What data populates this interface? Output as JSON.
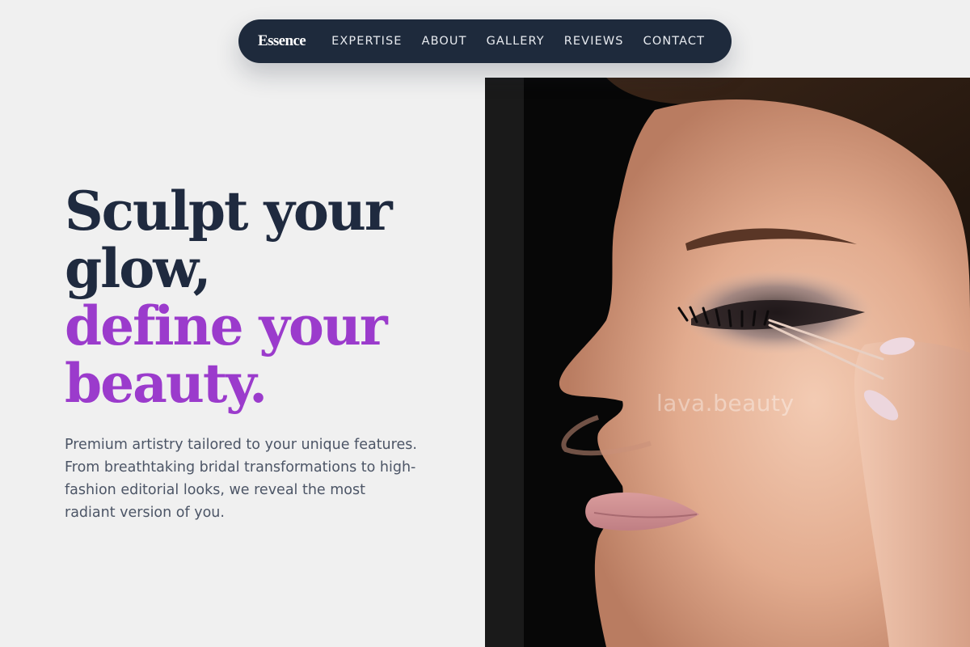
{
  "nav": {
    "brand": "Essence",
    "links": [
      "EXPERTISE",
      "ABOUT",
      "GALLERY",
      "REVIEWS",
      "CONTACT"
    ]
  },
  "hero": {
    "headline_line1": "Sculpt your",
    "headline_line2": "glow,",
    "headline_accent_line1": "define your",
    "headline_accent_line2": "beauty.",
    "lead": "Premium artistry tailored to your unique features. From breathtaking bridal transformations to high-fashion editorial looks, we reveal the most radiant version of you.",
    "image_watermark": "lava.beauty"
  },
  "colors": {
    "background": "#f0f0f0",
    "nav_background": "#1e2a3c",
    "headline_dark": "#1f2a3f",
    "headline_accent": "#9b3bcc",
    "body_text": "#4c5566"
  }
}
